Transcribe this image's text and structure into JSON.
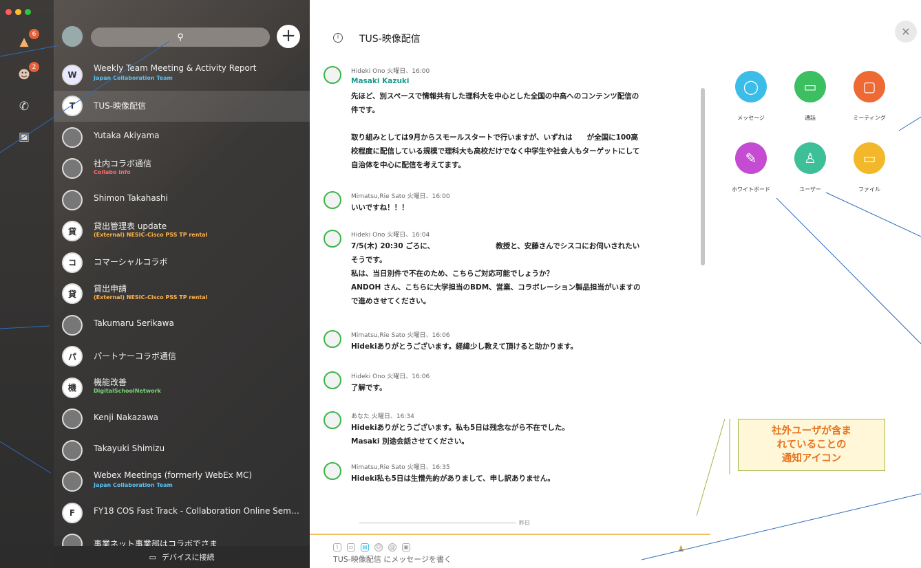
{
  "nav": {
    "badge_teams": "6",
    "badge_people": "2"
  },
  "search": {
    "icon": "search-icon"
  },
  "spaces": [
    {
      "initial": "W",
      "name": "Weekly Team Meeting & Activity Report",
      "sub": "Japan Collaboration Team",
      "sub_color": "#5bc0f0",
      "avatar_color": "#e8e8ff"
    },
    {
      "initial": "T",
      "name": "TUS-映像配信",
      "sub": "",
      "selected": true
    },
    {
      "initial": "",
      "name": "Yutaka Akiyama",
      "sub": ""
    },
    {
      "initial": "",
      "name": "社内コラボ通信",
      "sub": "Collabo info",
      "sub_color": "#ff6b6b"
    },
    {
      "initial": "",
      "name": "Shimon Takahashi",
      "sub": ""
    },
    {
      "initial": "貸",
      "name": "貸出管理表 update",
      "sub": "(External) NESIC-Cisco PSS TP rental",
      "sub_color": "#ffb347"
    },
    {
      "initial": "コ",
      "name": "コマーシャルコラボ",
      "sub": ""
    },
    {
      "initial": "貸",
      "name": "貸出申請",
      "sub": "(External) NESIC-Cisco PSS TP rental",
      "sub_color": "#ffb347"
    },
    {
      "initial": "",
      "name": "Takumaru Serikawa",
      "sub": ""
    },
    {
      "initial": "パ",
      "name": "パートナーコラボ通信",
      "sub": ""
    },
    {
      "initial": "機",
      "name": "機能改善",
      "sub": "DigitalSchoolNetwork",
      "sub_color": "#7ad37a"
    },
    {
      "initial": "",
      "name": "Kenji Nakazawa",
      "sub": ""
    },
    {
      "initial": "",
      "name": "Takayuki Shimizu",
      "sub": ""
    },
    {
      "initial": "",
      "name": "Webex Meetings (formerly WebEx MC)",
      "sub": "Japan Collaboration Team",
      "sub_color": "#5bc0f0"
    },
    {
      "initial": "F",
      "name": "FY18 COS Fast Track - Collaboration Online Semi...",
      "sub": ""
    },
    {
      "initial": "",
      "name": "事業ネット事業部はコラボでさま",
      "sub": ""
    }
  ],
  "device_bar": {
    "label": "デバイスに接続"
  },
  "chat": {
    "title": "TUS-映像配信",
    "messages": [
      {
        "meta": "Hideki Ono  火曜日、16:00",
        "lines": [
          "Masaki Kazuki",
          "先ほど、別スペースで情報共有した理科大を中心とした全国の中高へのコンテンツ配信の",
          "件です。",
          "",
          "取り組みとしては9月からスモールスタートで行いますが、いずれは　　が全国に100高",
          "校程度に配信している規模で理科大も高校だけでなく中学生や社会人もターゲットにして",
          "自治体を中心に配信を考えてます。"
        ]
      },
      {
        "meta": "Mimatsu,Rie Sato  火曜日、16:00",
        "lines": [
          "いいですね！！！"
        ]
      },
      {
        "meta": "Hideki Ono  火曜日、16:04",
        "lines": [
          "7/5(木) 20:30 ごろに、　　　　　　　　　教授と、安藤さんでシスコにお伺いされたい",
          "そうです。",
          "私は、当日別件で不在のため、こちらご対応可能でしょうか？",
          "ANDOH さん、こちらに大学担当のBDM、営業、コラボレーション製品担当がいますの",
          "で進めさせてください。"
        ]
      },
      {
        "meta": "Mimatsu,Rie Sato  火曜日、16:06",
        "lines": [
          "Hidekiありがとうございます。経緯少し教えて頂けると助かります。"
        ]
      },
      {
        "meta": "Hideki Ono  火曜日、16:06",
        "lines": [
          "了解です。"
        ]
      },
      {
        "meta": "あなた  火曜日、16:34",
        "lines": [
          "Hidekiありがとうございます。私も5日は残念ながら不在でした。",
          "Masaki 別途会話させてください。"
        ]
      },
      {
        "meta": "Mimatsu,Rie Sato  火曜日、16:35",
        "lines": [
          "Hideki私も5日は生憎先約がありまして、申し訳ありません。"
        ]
      }
    ],
    "divider": "昨日",
    "compose_placeholder": "TUS-映像配信 にメッセージを書く"
  },
  "actions": [
    {
      "label": "メッセージ",
      "color": "#3bbde8",
      "icon": "message-icon",
      "glyph": "◯"
    },
    {
      "label": "通話",
      "color": "#3cbf60",
      "icon": "video-icon",
      "glyph": "▭"
    },
    {
      "label": "ミーティング",
      "color": "#ee6a34",
      "icon": "calendar-icon",
      "glyph": "▢"
    },
    {
      "label": "ホワイトボード",
      "color": "#c44bd2",
      "icon": "pencil-icon",
      "glyph": "✎"
    },
    {
      "label": "ユーザー",
      "color": "#3dbf97",
      "icon": "user-icon",
      "glyph": "♙"
    },
    {
      "label": "ファイル",
      "color": "#f3b82a",
      "icon": "folder-icon",
      "glyph": "▭"
    }
  ],
  "note": {
    "line1": "社外ユーザが含ま",
    "line2": "れていることの",
    "line3": "通知アイコン"
  },
  "close": "×"
}
